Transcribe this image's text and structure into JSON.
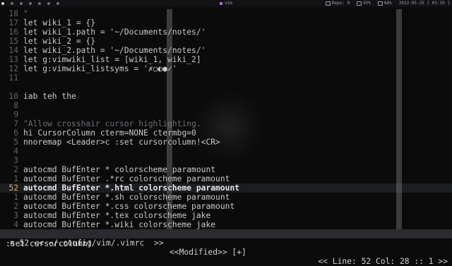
{
  "topbar": {
    "title": "vim",
    "repo": "Repo: 0",
    "mem": "93%",
    "bat": "88%",
    "datetime": "2022-05-25 [ 01:10 ]"
  },
  "editor": {
    "lines": [
      {
        "num": "18",
        "text": "\""
      },
      {
        "num": "17",
        "text": "let wiki_1 = {}"
      },
      {
        "num": "16",
        "text": "let wiki_1.path = '~/Documents/notes/'"
      },
      {
        "num": "15",
        "text": "let wiki_2 = {}"
      },
      {
        "num": "14",
        "text": "let wiki_2.path = '~/Documents/notes/'"
      },
      {
        "num": "13",
        "text": "let g:vimwiki_list = [wiki_1, wiki_2]"
      },
      {
        "num": "12",
        "text": "let g:vimwiki_listsyms = '✗○◐●✓'"
      },
      {
        "num": "11",
        "text": ""
      },
      {
        "num": "10",
        "text": "iab teh the"
      },
      {
        "num": "9",
        "text": ""
      },
      {
        "num": "8",
        "text": ""
      },
      {
        "num": "7",
        "text": "\"Allow crosshair cursor highlighting."
      },
      {
        "num": "6",
        "text": "hi CursorColumn cterm=NONE ctermbg=0"
      },
      {
        "num": "5",
        "text": "nnoremap <Leader>c :set cursorcolumn!<CR>"
      },
      {
        "num": "4",
        "text": ""
      },
      {
        "num": "3",
        "text": ""
      },
      {
        "num": "2",
        "text": "autocmd BufEnter * colorscheme paramount"
      },
      {
        "num": "1",
        "text": "autocmd BufEnter .*rc colorscheme paramount"
      },
      {
        "num": "52",
        "text": "autocmd BufEnter *.html colorscheme paramount"
      },
      {
        "num": "1",
        "text": "autocmd BufEnter *.sh colorscheme paramount"
      },
      {
        "num": "2",
        "text": "autocmd BufEnter *.css colorscheme paramount"
      },
      {
        "num": "3",
        "text": "autocmd BufEnter *.tex colorscheme jake"
      },
      {
        "num": "4",
        "text": "autocmd BufEnter *.wiki colorscheme jake"
      }
    ]
  },
  "statusbar": {
    "left": "n 52 << ~/.config/vim/.vimrc  >>",
    "middle": "<<Modified>> [+]",
    "right": "<< Line: 52 Col: 28 :: 1 >>"
  },
  "cmdline": ":set cursorcolumn!",
  "colors": {
    "background": "#0b0b0c",
    "statusbar": "#2a2b2e",
    "string": "#d89c7a",
    "current_line_number": "#d6b25a"
  }
}
